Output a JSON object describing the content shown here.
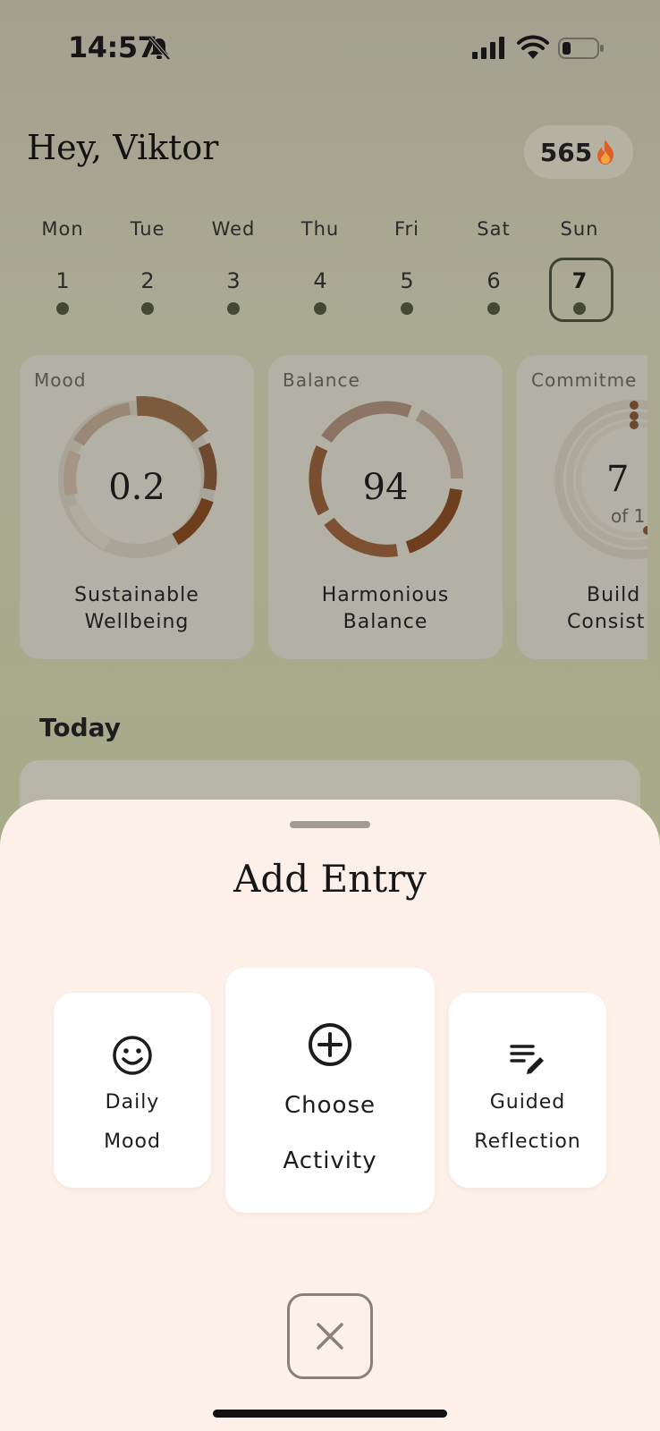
{
  "status_bar": {
    "time": "14:57",
    "icons": [
      "bell-slash-icon",
      "cellular-signal-icon",
      "wifi-icon",
      "battery-icon"
    ]
  },
  "header": {
    "greeting": "Hey, Viktor",
    "streak_count": "565",
    "streak_icon": "flame-icon"
  },
  "week": {
    "days": [
      {
        "name": "Mon",
        "num": "1"
      },
      {
        "name": "Tue",
        "num": "2"
      },
      {
        "name": "Wed",
        "num": "3"
      },
      {
        "name": "Thu",
        "num": "4"
      },
      {
        "name": "Fri",
        "num": "5"
      },
      {
        "name": "Sat",
        "num": "6"
      },
      {
        "name": "Sun",
        "num": "7"
      }
    ],
    "selected_day": "7"
  },
  "cards": [
    {
      "title": "Mood",
      "value": "0.2",
      "caption_line1": "Sustainable",
      "caption_line2": "Wellbeing"
    },
    {
      "title": "Balance",
      "value": "94",
      "caption_line1": "Harmonious",
      "caption_line2": "Balance"
    },
    {
      "title": "Commitme",
      "value": "7",
      "sub": "of 1",
      "caption_line1": "Build",
      "caption_line2": "Consist"
    }
  ],
  "today": {
    "label": "Today"
  },
  "sheet": {
    "title": "Add Entry",
    "options": [
      {
        "icon": "smiley-face-icon",
        "line1": "Daily",
        "line2": "Mood"
      },
      {
        "icon": "plus-circle-icon",
        "line1": "Choose",
        "line2": "Activity"
      },
      {
        "icon": "edit-note-icon",
        "line1": "Guided",
        "line2": "Reflection"
      }
    ],
    "close_icon": "close-icon"
  },
  "colors": {
    "sheet_background": "#fdf0e8",
    "accent_brown": "#8a5a36",
    "dark_olive": "#3d4232"
  }
}
